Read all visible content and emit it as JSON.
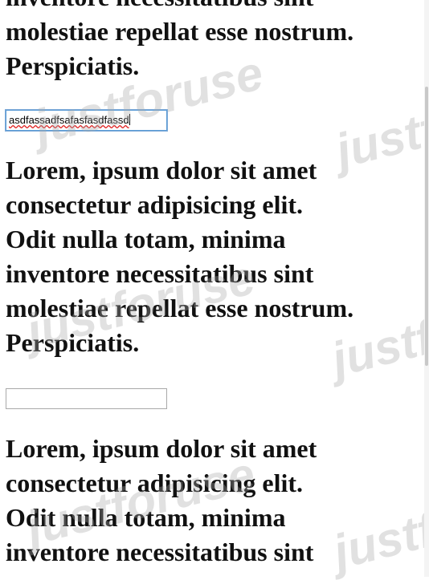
{
  "paragraphs": [
    "inventore necessitatibus sint\nmolestiae repellat esse nostrum.\nPerspiciatis.",
    "Lorem, ipsum dolor sit amet\nconsectetur adipisicing elit.\nOdit nulla totam, minima\ninventore necessitatibus sint\nmolestiae repellat esse nostrum.\nPerspiciatis.",
    "Lorem, ipsum dolor sit amet\nconsectetur adipisicing elit.\nOdit nulla totam, minima\ninventore necessitatibus sint"
  ],
  "inputs": [
    {
      "value": "asdfassadfsafasfasdfassd",
      "state": "focused"
    },
    {
      "value": "",
      "state": "empty"
    }
  ],
  "watermark": {
    "text": "justforuse"
  },
  "colors": {
    "focus_border": "#5b9bd5",
    "spellcheck": "#e02020",
    "text": "#111111"
  }
}
